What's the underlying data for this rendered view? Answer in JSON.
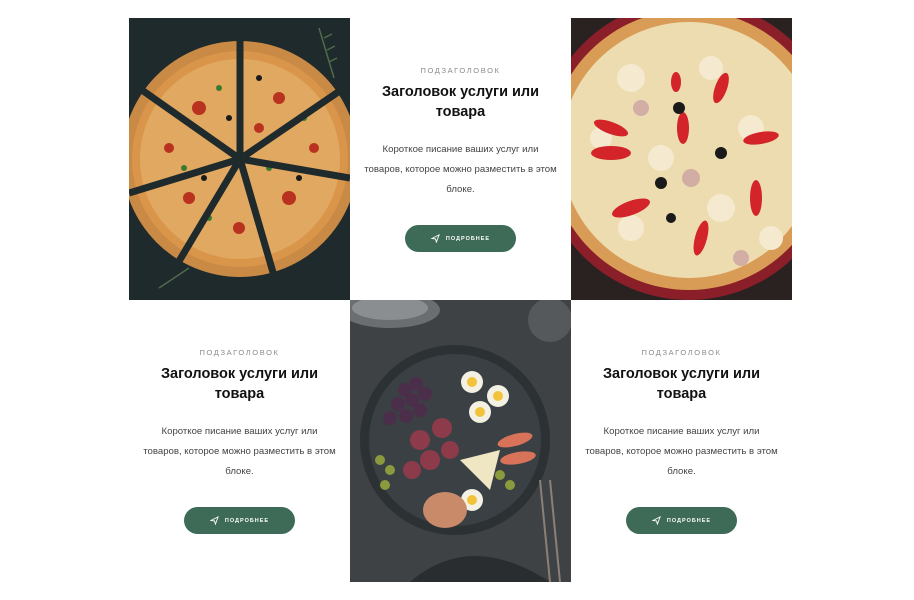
{
  "blocks": [
    {
      "subheading": "ПОДЗАГОЛОВОК",
      "heading": "Заголовок услуги или товара",
      "description": "Короткое писание ваших услуг или товаров, которое можно разместить в этом блоке.",
      "button_label": "ПОДРОБНЕЕ",
      "button_icon": "paper-plane-icon"
    },
    {
      "subheading": "ПОДЗАГОЛОВОК",
      "heading": "Заголовок услуги или товара",
      "description": "Короткое писание ваших услуг или товаров, которое можно разместить в этом блоке.",
      "button_label": "ПОДРОБНЕЕ",
      "button_icon": "paper-plane-icon"
    },
    {
      "subheading": "ПОДЗАГОЛОВОК",
      "heading": "Заголовок услуги или товара",
      "description": "Короткое писание ваших услуг или товаров, которое можно разместить в этом блоке.",
      "button_label": "ПОДРОБНЕЕ",
      "button_icon": "paper-plane-icon"
    }
  ],
  "images": [
    {
      "subject": "sliced-pizza-photo"
    },
    {
      "subject": "mushroom-pepper-pizza-photo"
    },
    {
      "subject": "appetizer-platter-photo"
    }
  ],
  "colors": {
    "button": "#3d6b58",
    "heading": "#111111",
    "subheading": "#8a8a8a",
    "description": "#444444",
    "background": "#ffffff"
  }
}
